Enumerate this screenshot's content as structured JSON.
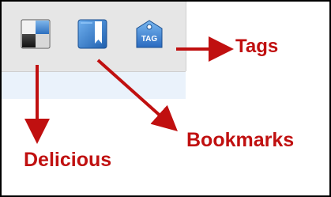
{
  "toolbar": {
    "buttons": [
      {
        "id": "delicious",
        "icon": "delicious-icon"
      },
      {
        "id": "bookmarks",
        "icon": "bookmark-icon"
      },
      {
        "id": "tags",
        "icon": "tag-icon",
        "text": "TAG"
      }
    ]
  },
  "callouts": {
    "tags": "Tags",
    "bookmarks": "Bookmarks",
    "delicious": "Delicious"
  },
  "colors": {
    "callout": "#c01010",
    "icon_blue": "#3a7dc9",
    "toolbar_bg": "#e6e6e6",
    "frame_border": "#000000"
  }
}
